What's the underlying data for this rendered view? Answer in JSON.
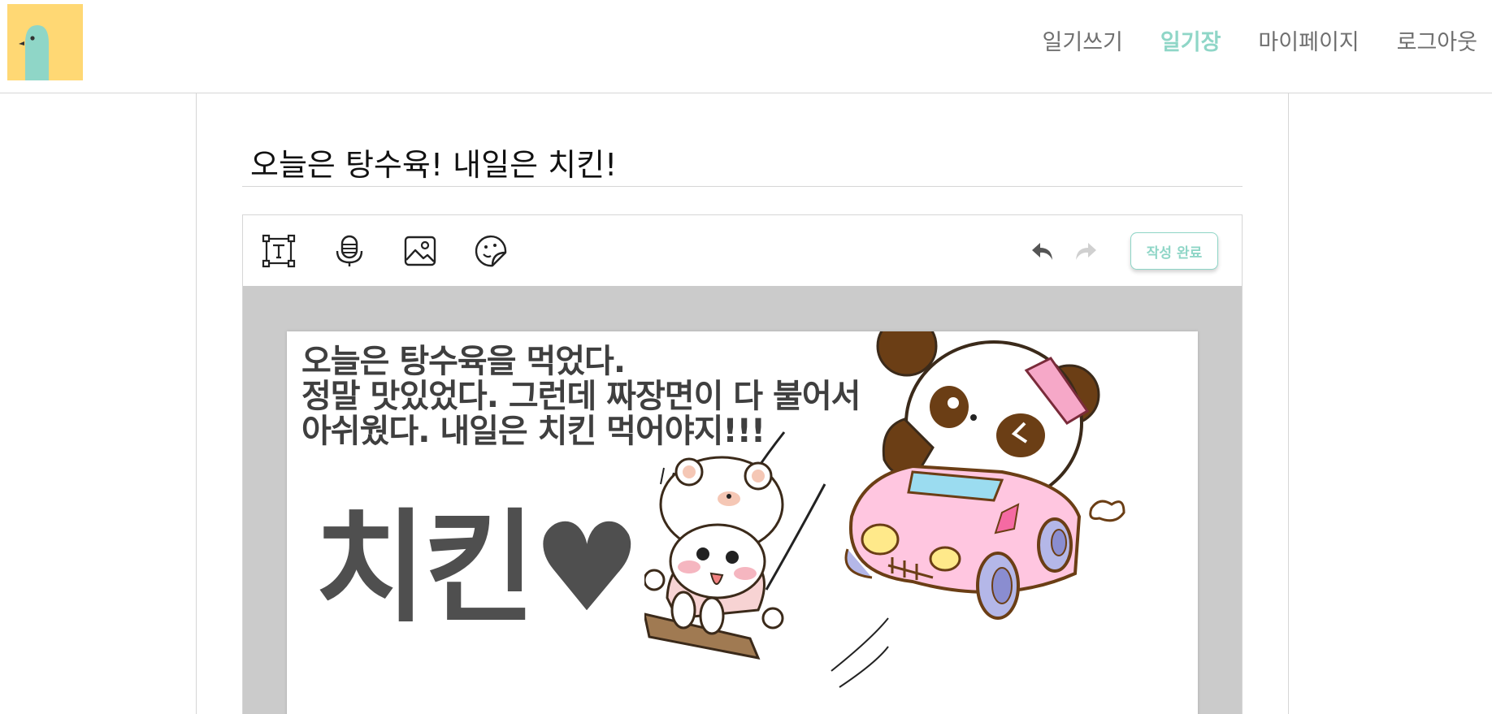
{
  "nav": {
    "items": [
      {
        "label": "일기쓰기",
        "active": false
      },
      {
        "label": "일기장",
        "active": true
      },
      {
        "label": "마이페이지",
        "active": false
      },
      {
        "label": "로그아웃",
        "active": false
      }
    ]
  },
  "diary": {
    "title": "오늘은 탕수육! 내일은 치킨!",
    "body_lines": [
      "오늘은 탕수육을 먹었다.",
      "정말 맛있었다. 그런데 짜장면이 다 불어서",
      "아쉬웠다. 내일은 치킨 먹어야지!!!"
    ],
    "big_text": "치킨♥"
  },
  "toolbar": {
    "tools": [
      "text-tool-icon",
      "voice-tool-icon",
      "image-tool-icon",
      "sticker-tool-icon"
    ],
    "done_label": "작성 완료"
  },
  "colors": {
    "accent": "#8fd6c7",
    "logo_bg": "#ffd874",
    "canvas_bg": "#cbcbcb"
  }
}
